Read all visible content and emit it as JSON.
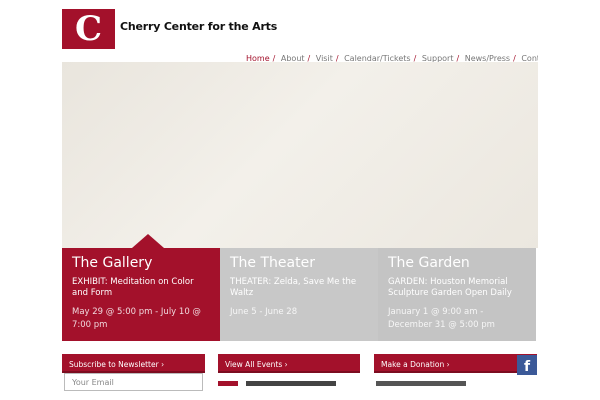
{
  "header": {
    "logo_letter": "C",
    "site_name": "Cherry Center for the Arts"
  },
  "nav": {
    "items": [
      "Home",
      "About",
      "Visit",
      "Calendar/Tickets",
      "Support",
      "News/Press",
      "Contact"
    ],
    "separator": "/"
  },
  "panels": [
    {
      "title": "The Gallery",
      "event": "EXHIBIT: Meditation on Color and Form",
      "dates": "May 29 @ 5:00 pm - July 10 @ 7:00 pm"
    },
    {
      "title": "The Theater",
      "event": "THEATER: Zelda, Save Me the Waltz",
      "dates": "June 5 - June 28"
    },
    {
      "title": "The Garden",
      "event": "GARDEN: Houston Memorial Sculpture Garden Open Daily",
      "dates": "January 1 @ 9:00 am - December 31 @ 5:00 pm"
    }
  ],
  "footer": {
    "newsletter_label": "Subscribe to Newsletter ›",
    "email_placeholder": "Your Email",
    "events_label": "View All Events ›",
    "donate_label": "Make a Donation ›",
    "facebook_glyph": "f"
  },
  "colors": {
    "accent": "#a3112b",
    "panel_grey": "#c8c8c8",
    "facebook": "#3b5998"
  }
}
